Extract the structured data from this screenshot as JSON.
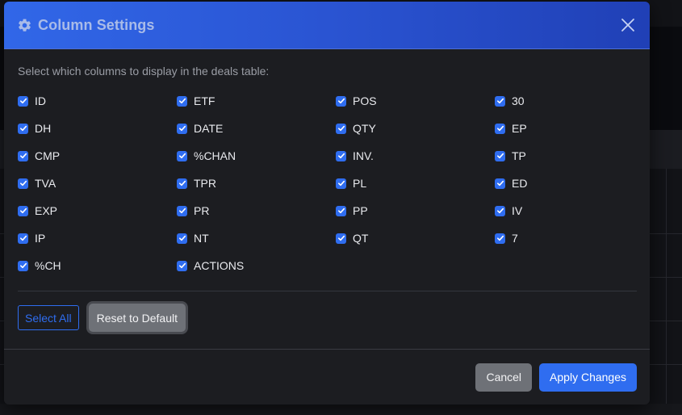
{
  "modal": {
    "title": "Column Settings",
    "instructions": "Select which columns to display in the deals table:",
    "columns": [
      [
        "ID",
        "DH",
        "CMP",
        "TVA",
        "EXP",
        "IP",
        "%CH"
      ],
      [
        "ETF",
        "DATE",
        "%CHAN",
        "TPR",
        "PR",
        "NT",
        "ACTIONS"
      ],
      [
        "POS",
        "QTY",
        "INV.",
        "PL",
        "PP",
        "QT"
      ],
      [
        "30",
        "EP",
        "TP",
        "ED",
        "IV",
        "7"
      ]
    ],
    "select_all_label": "Select All",
    "reset_label": "Reset to Default",
    "cancel_label": "Cancel",
    "apply_label": "Apply Changes"
  },
  "colors": {
    "accent": "#2f6df0",
    "header_gradient_start": "#3167e8",
    "header_gradient_end": "#2040b6",
    "modal_bg": "#1c1d21",
    "secondary_button": "#6e7177"
  },
  "icons": {
    "title_icon": "gear-icon",
    "close": "close-icon",
    "checkbox": "checkmark-icon"
  }
}
